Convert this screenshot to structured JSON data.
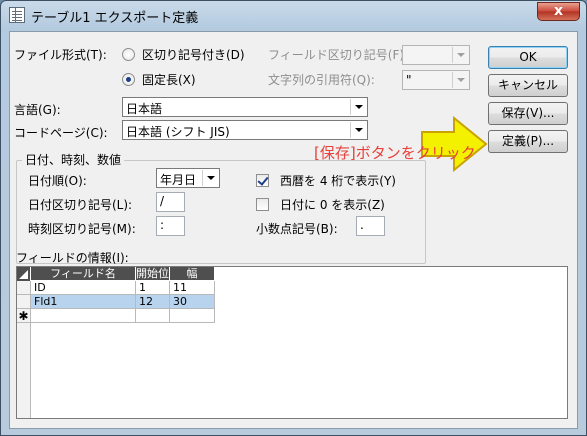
{
  "window": {
    "title": "テーブル1 エクスポート定義",
    "close_glyph": "x"
  },
  "format": {
    "label": "ファイル形式(T):",
    "options": [
      {
        "label": "区切り記号付き(D)",
        "selected": false
      },
      {
        "label": "固定長(X)",
        "selected": true
      }
    ]
  },
  "field_delimiter": {
    "label": "フィールド区切り記号(F):",
    "value": "",
    "enabled": false
  },
  "text_qualifier": {
    "label": "文字列の引用符(Q):",
    "value": "\"",
    "enabled": false
  },
  "language": {
    "label": "言語(G):",
    "value": "日本語"
  },
  "code_page": {
    "label": "コードページ(C):",
    "value": "日本語 (シフト JIS)"
  },
  "buttons": {
    "ok": "OK",
    "cancel": "キャンセル",
    "save": "保存(V)...",
    "specs": "定義(P)..."
  },
  "annotation": {
    "text": "[保存]ボタンをクリック",
    "color": "#e8403a",
    "arrow_color": "#f3f000"
  },
  "dates_group": {
    "title": "日付、時刻、数値",
    "date_order": {
      "label": "日付順(O):",
      "value": "年月日"
    },
    "date_delimiter": {
      "label": "日付区切り記号(L):",
      "value": "/"
    },
    "time_delimiter": {
      "label": "時刻区切り記号(M):",
      "value": ":"
    },
    "four_digit_years": {
      "label": "西暦を 4 桁で表示(Y)",
      "checked": true
    },
    "leading_zeros": {
      "label": "日付に 0 を表示(Z)",
      "checked": false
    },
    "decimal_symbol": {
      "label": "小数点記号(B):",
      "value": "."
    }
  },
  "field_info": {
    "label": "フィールドの情報(I):",
    "columns": [
      "フィールド名",
      "開始位置",
      "幅"
    ],
    "rows": [
      {
        "name": "ID",
        "start": "1",
        "width": "11"
      },
      {
        "name": "Fld1",
        "start": "12",
        "width": "30"
      }
    ],
    "new_row_glyph": "✱"
  }
}
